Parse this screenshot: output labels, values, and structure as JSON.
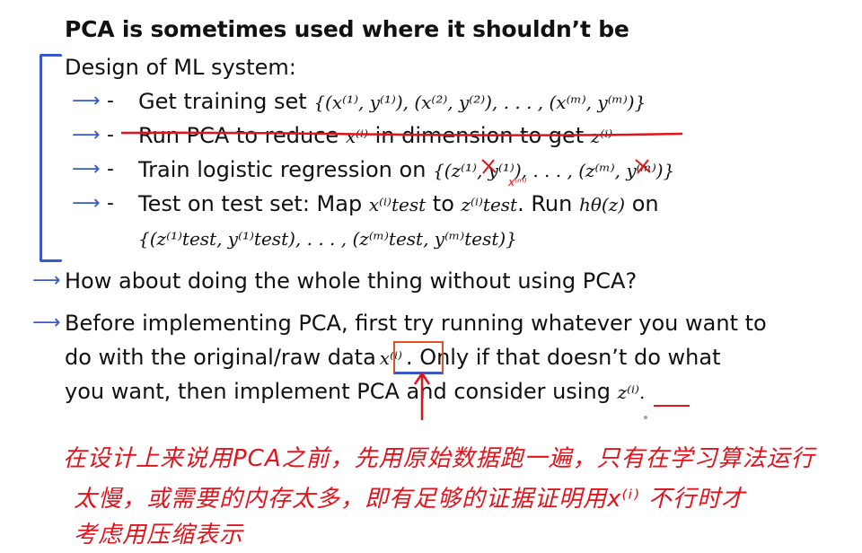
{
  "title": "PCA is sometimes used where it shouldn’t be",
  "section_heading": "Design of ML system:",
  "steps": [
    {
      "text": "Get training set",
      "math": "{(x⁽¹⁾, y⁽¹⁾), (x⁽²⁾, y⁽²⁾), . . . , (x⁽ᵐ⁾, y⁽ᵐ⁾)}"
    },
    {
      "text_a": "Run PCA to reduce",
      "math_a": "x⁽ⁱ⁾",
      "text_b": "in dimension to get",
      "math_b": "z⁽ⁱ⁾"
    },
    {
      "text": "Train logistic regression on",
      "math": "{(z⁽¹⁾, y⁽¹⁾), . . . , (z⁽ᵐ⁾, y⁽ᵐ⁾)}"
    },
    {
      "text_a": "Test on test set: Map",
      "math_a": "x⁽ⁱ⁾test",
      "text_b": "to",
      "math_b": "z⁽ⁱ⁾test",
      "text_c": ". Run",
      "math_c": "hθ(z)",
      "text_d": "on",
      "math_d": "{(z⁽¹⁾test, y⁽¹⁾test), . . . , (z⁽ᵐ⁾test, y⁽ᵐ⁾test)}"
    }
  ],
  "dash": "-",
  "question": "How about doing the whole thing without using PCA?",
  "advice_line1": "Before implementing PCA, first try running whatever you want to",
  "advice_line2_a": "do with the original/raw data",
  "advice_line2_math": "x⁽ⁱ⁾",
  "advice_line2_b": ". Only if that doesn’t do what",
  "advice_line3_a": "you want, then implement PCA and consider using",
  "advice_line3_math": "z⁽ⁱ⁾.",
  "annotation_small": "x⁽ᵐ⁾",
  "handwriting": {
    "line1": "在设计上来说用PCA之前，先用原始数据跑一遍，只有在学习算法运行",
    "line2": "太慢，或需要的内存太多，即有足够的证据证明用x⁽ⁱ⁾ 不行时才",
    "line3": "考虑用压缩表示"
  },
  "colors": {
    "arrow": "#3a59c9",
    "annotation": "#e0141c",
    "box": "#e04f25"
  }
}
